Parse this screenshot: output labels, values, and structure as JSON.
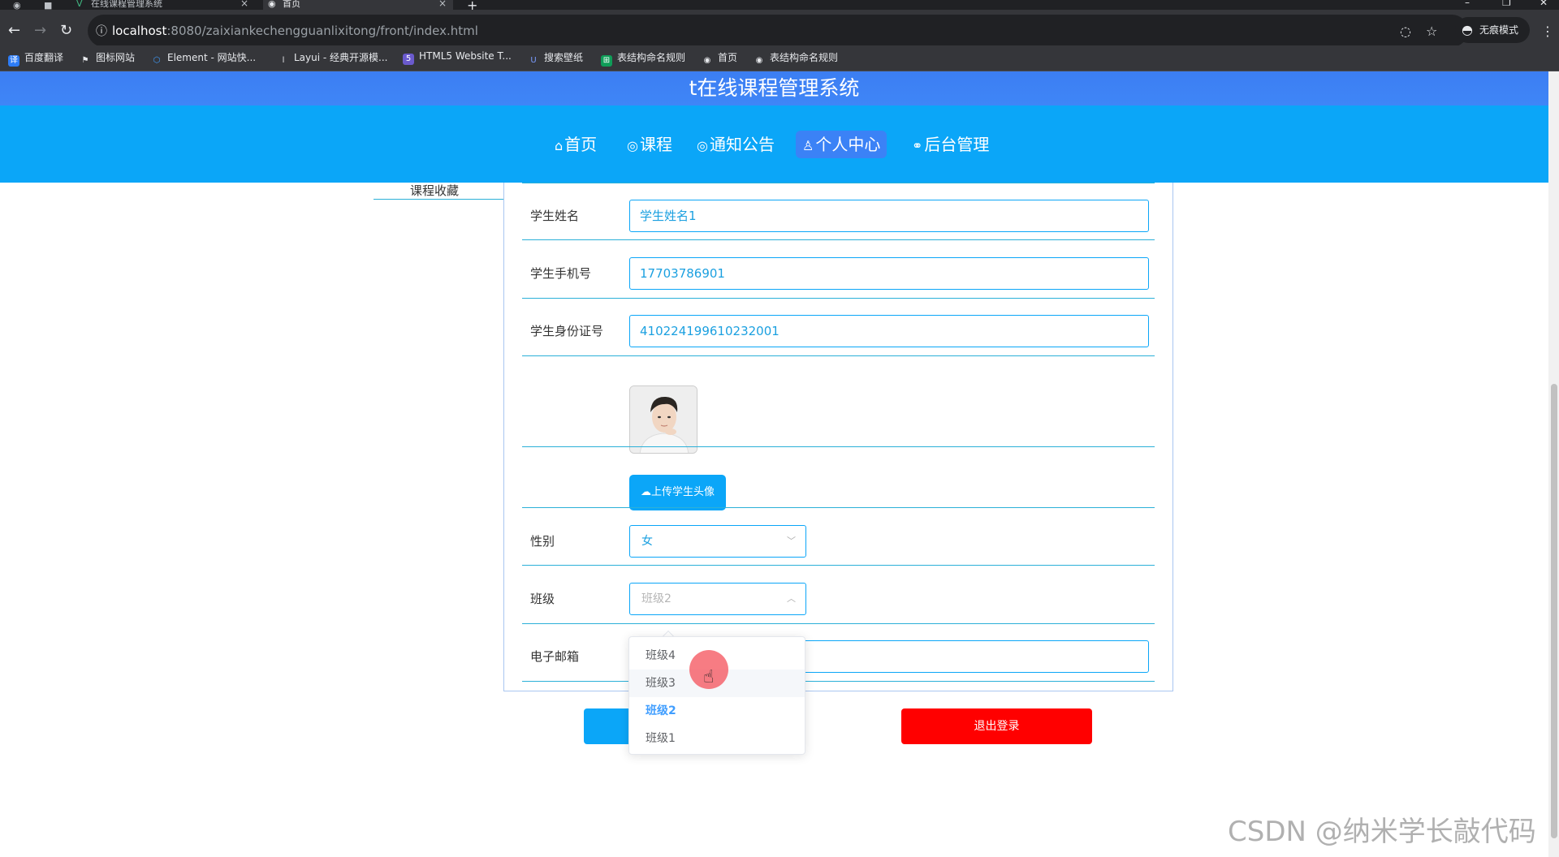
{
  "browser": {
    "tabs": [
      {
        "title": "在线课程管理系统",
        "icon": "vue-icon"
      },
      {
        "title": "首页",
        "icon": "globe-icon"
      }
    ],
    "url_host": "localhost",
    "url_path": ":8080/zaixiankechengguanlixitong/front/index.html",
    "incognito_label": "无痕模式",
    "bookmarks": [
      {
        "label": "百度翻译",
        "icon": "baidu-translate-icon",
        "color": "#2d7cf6"
      },
      {
        "label": "图标网站",
        "icon": "flag-icon",
        "color": "#444444"
      },
      {
        "label": "Element - 网站快...",
        "icon": "element-icon",
        "color": "#409eff"
      },
      {
        "label": "Layui - 经典开源模...",
        "icon": "layui-icon",
        "color": "#444444"
      },
      {
        "label": "HTML5 Website T...",
        "icon": "html5-icon",
        "color": "#6a5acd"
      },
      {
        "label": "搜索壁纸",
        "icon": "wallpaper-icon",
        "color": "#3b5bdb"
      },
      {
        "label": "表结构命名规则",
        "icon": "sheet-icon",
        "color": "#0f9d58"
      },
      {
        "label": "首页",
        "icon": "globe-icon",
        "color": "#444444"
      },
      {
        "label": "表结构命名规则",
        "icon": "globe-icon",
        "color": "#444444"
      }
    ]
  },
  "site": {
    "title": "t在线课程管理系统",
    "nav": [
      {
        "label": "首页",
        "icon": "home-icon",
        "glyph": "⌂"
      },
      {
        "label": "课程",
        "icon": "course-icon",
        "glyph": "◎"
      },
      {
        "label": "通知公告",
        "icon": "notice-icon",
        "glyph": "◎"
      },
      {
        "label": "个人中心",
        "icon": "user-icon",
        "glyph": "♙",
        "active": true
      },
      {
        "label": "后台管理",
        "icon": "link-icon",
        "glyph": "⚭"
      }
    ],
    "sidebar_remnant": "课程收藏"
  },
  "form": {
    "student_name": {
      "label": "学生姓名",
      "value": "学生姓名1"
    },
    "student_phone": {
      "label": "学生手机号",
      "value": "17703786901"
    },
    "student_id_card": {
      "label": "学生身份证号",
      "value": "410224199610232001"
    },
    "upload_avatar_label": "上传学生头像",
    "gender": {
      "label": "性别",
      "value": "女"
    },
    "class": {
      "label": "班级",
      "placeholder": "班级2",
      "options": [
        "班级4",
        "班级3",
        "班级2",
        "班级1"
      ],
      "selected": "班级2",
      "hovered": "班级3"
    },
    "email": {
      "label": "电子邮箱",
      "value": ""
    },
    "logout_label": "退出登录"
  },
  "watermark": "CSDN @纳米学长敲代码",
  "colors": {
    "nav_bg": "#0ba6f8",
    "title_bg": "#3c7ef2",
    "active_nav": "#3b82f6",
    "logout": "#ff0000",
    "line": "#2bb0d8"
  }
}
